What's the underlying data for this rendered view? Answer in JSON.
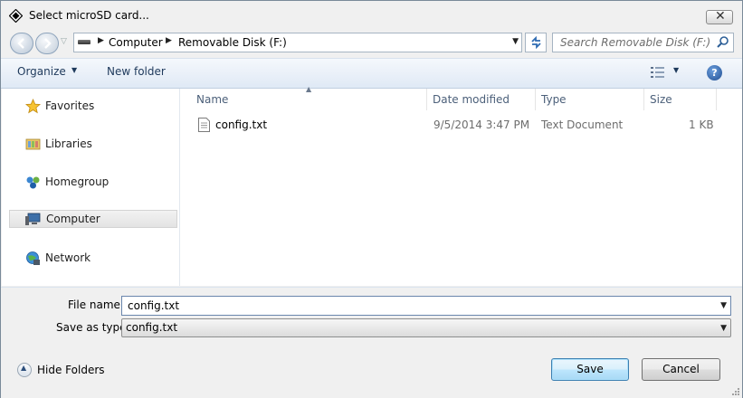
{
  "window": {
    "title": "Select microSD card..."
  },
  "address": {
    "segments": [
      "Computer",
      "Removable Disk (F:)"
    ]
  },
  "search": {
    "placeholder": "Search Removable Disk (F:)"
  },
  "toolbar": {
    "organize_label": "Organize",
    "new_folder_label": "New folder",
    "help_label": "?"
  },
  "sidebar": {
    "items": [
      {
        "label": "Favorites",
        "icon": "star-icon"
      },
      {
        "label": "Libraries",
        "icon": "libraries-icon"
      },
      {
        "label": "Homegroup",
        "icon": "homegroup-icon"
      },
      {
        "label": "Computer",
        "icon": "computer-icon",
        "selected": true
      },
      {
        "label": "Network",
        "icon": "network-icon"
      }
    ]
  },
  "files": {
    "columns": [
      "Name",
      "Date modified",
      "Type",
      "Size"
    ],
    "rows": [
      {
        "name": "config.txt",
        "date": "9/5/2014 3:47 PM",
        "type": "Text Document",
        "size": "1 KB"
      }
    ]
  },
  "bottom": {
    "file_name_label": "File name:",
    "file_name_value": "config.txt",
    "save_type_label": "Save as type:",
    "save_type_value": "config.txt",
    "hide_folders_label": "Hide Folders",
    "save_label": "Save",
    "cancel_label": "Cancel"
  },
  "colors": {
    "toolbar_text": "#1e395b",
    "header_text": "#4c607a",
    "accent": "#3c7fb1"
  }
}
